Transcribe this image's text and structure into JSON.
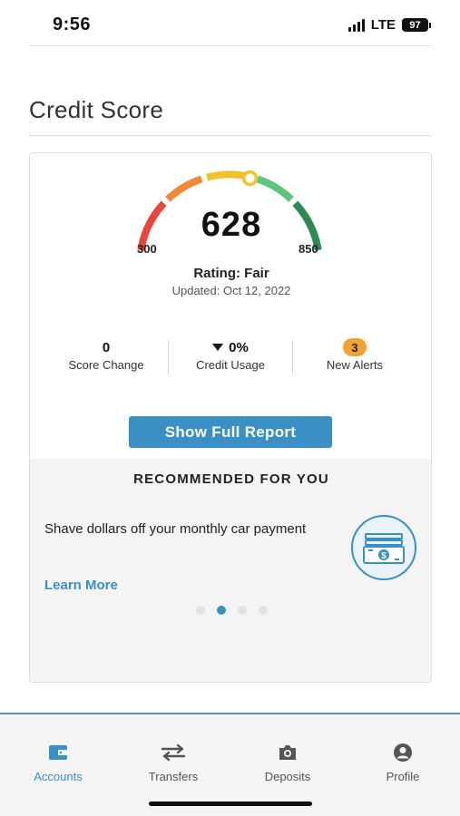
{
  "status_bar": {
    "time": "9:56",
    "network": "LTE",
    "battery": "97"
  },
  "page": {
    "title": "Credit Score"
  },
  "credit": {
    "score": "628",
    "range_min": "300",
    "range_max": "850",
    "score_fraction": 0.6,
    "rating": "Rating: Fair",
    "updated": "Updated: Oct 12, 2022",
    "gauge_colors": [
      "#e8453c",
      "#ee8a3a",
      "#f0c22e",
      "#5ec57e",
      "#2e8a55"
    ]
  },
  "stats": {
    "score_change": {
      "value": "0",
      "label": "Score Change"
    },
    "credit_usage": {
      "value": "0%",
      "label": "Credit Usage",
      "icon": "down-triangle-icon"
    },
    "new_alerts": {
      "value": "3",
      "label": "New Alerts"
    }
  },
  "actions": {
    "full_report_label": "Show Full Report"
  },
  "recommended": {
    "heading": "RECOMMENDED FOR YOU",
    "text": "Shave dollars off your monthly car payment",
    "link_label": "Learn More",
    "icon": "money-stack-icon",
    "page_count": 4,
    "active_page": 2
  },
  "tabbar": {
    "tabs": [
      {
        "label": "Accounts",
        "icon": "wallet-icon",
        "active": true
      },
      {
        "label": "Transfers",
        "icon": "transfer-arrows-icon",
        "active": false
      },
      {
        "label": "Deposits",
        "icon": "camera-icon",
        "active": false
      },
      {
        "label": "Profile",
        "icon": "profile-icon",
        "active": false
      }
    ]
  },
  "colors": {
    "accent": "#3a8fc4",
    "badge": "#f0a332"
  }
}
